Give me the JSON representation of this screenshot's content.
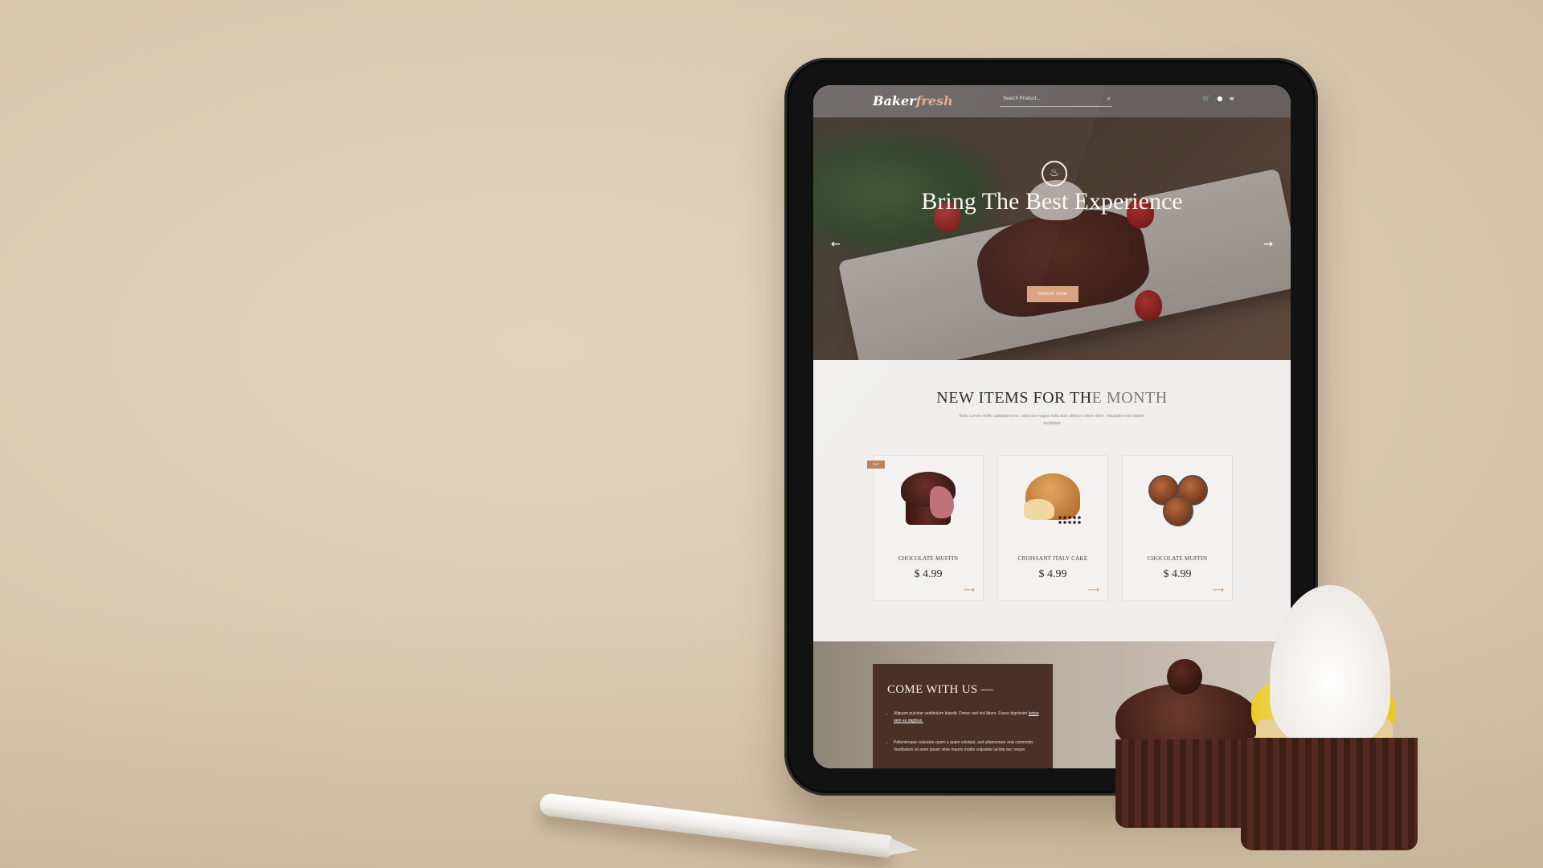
{
  "site": {
    "logo_primary": "Baker",
    "logo_accent": "fresh",
    "search_placeholder": "Search Product...",
    "icons": [
      "cart-icon",
      "user-icon",
      "menu-icon"
    ]
  },
  "hero": {
    "title": "Bring The Best Experience",
    "cta": "ORDER NOW",
    "prev_arrow": "←",
    "next_arrow": "→"
  },
  "new_items": {
    "title_main": "NEW ITEMS FOR TH",
    "title_faded": "E MONTH",
    "description": "Nulla Lorem mollit cupidatat irure. Laborum magna nulla duis ullamco cillum dolor. Voluptate exercitation incididunt",
    "products": [
      {
        "name": "CHOCOLATE MUFFIN",
        "price": "$ 4.99",
        "badge": "OUT"
      },
      {
        "name": "CROISSANT ITALY CAKE",
        "price": "$ 4.99"
      },
      {
        "name": "CHOCOLATE MUFFIN",
        "price": "$ 4.99"
      }
    ]
  },
  "come_with_us": {
    "title": "COME WITH US —",
    "item1_text": "Aliquam pulvinar vestibulum blandit. Donec sed nisl libero. Fusce dignissim ",
    "item1_link": "luctus sem eu dapibus.",
    "item2_text": "Pellentesque vulputate quam a quam volutpat, sed ullamcorper erat commodo. Vestibulum sit amet ipsum vitae mauris mattis vulputate lacinia nec neque."
  },
  "colors": {
    "accent": "#d9a382",
    "nav_bg": "#5a5552",
    "come_box": "#4a3025",
    "background": "#dccbb3"
  }
}
